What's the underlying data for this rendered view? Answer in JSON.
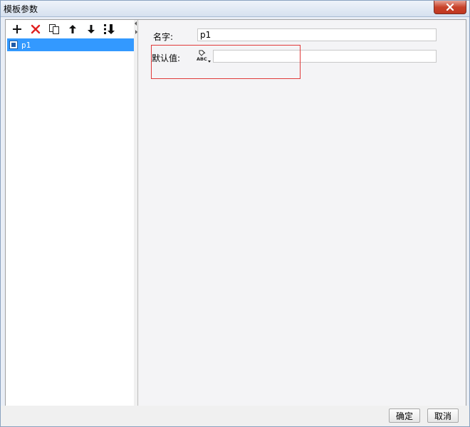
{
  "window": {
    "title": "模板参数",
    "icons": {
      "close": "close-icon"
    }
  },
  "toolbar": {
    "buttons": [
      {
        "name": "add-button",
        "icon": "plus-icon"
      },
      {
        "name": "delete-button",
        "icon": "delete-x-icon"
      },
      {
        "name": "copy-button",
        "icon": "copy-icon"
      },
      {
        "name": "move-up-button",
        "icon": "arrow-up-icon"
      },
      {
        "name": "move-down-button",
        "icon": "arrow-down-icon"
      },
      {
        "name": "sort-button",
        "icon": "sort-down-icon"
      }
    ]
  },
  "param_list": {
    "items": [
      {
        "label": "p1",
        "selected": true,
        "icon": "parameter-icon"
      }
    ]
  },
  "form": {
    "name_label": "名字:",
    "name_value": "p1",
    "default_label": "默认值:",
    "default_value": "",
    "type_icon": "string-type-abc-icon"
  },
  "footer": {
    "ok_label": "确定",
    "cancel_label": "取消"
  },
  "colors": {
    "selection": "#3399ff",
    "delete_icon": "#e02020",
    "highlight_border": "#e03a3a",
    "close_button": "#c8432b"
  }
}
